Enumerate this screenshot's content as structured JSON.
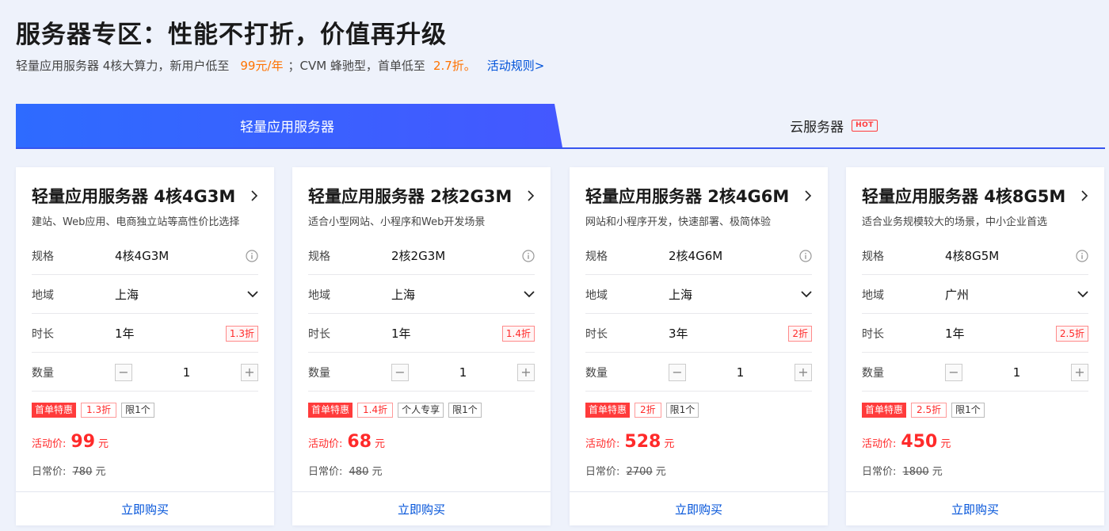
{
  "header": {
    "title": "服务器专区：性能不打折，价值再升级",
    "subtitle_part1": "轻量应用服务器 4核大算力，新用户低至",
    "subtitle_price": "99元/年",
    "subtitle_part2": "；CVM 蜂驰型，首单低至",
    "subtitle_discount": "2.7折。",
    "rules_link": "活动规则>"
  },
  "tabs": [
    {
      "label": "轻量应用服务器",
      "active": true
    },
    {
      "label": "云服务器",
      "badge": "HOT",
      "active": false
    }
  ],
  "labels": {
    "spec": "规格",
    "region": "地域",
    "duration": "时长",
    "quantity": "数量",
    "price_label": "活动价:",
    "orig_label": "日常价:",
    "unit": "元",
    "buy": "立即购买",
    "first_order": "首单特惠",
    "limit": "限1个",
    "personal": "个人专享"
  },
  "cards": [
    {
      "title": "轻量应用服务器 4核4G3M",
      "desc": "建站、Web应用、电商独立站等高性价比选择",
      "spec": "4核4G3M",
      "region": "上海",
      "duration": "1年",
      "discount": "1.3折",
      "quantity": "1",
      "price": "99",
      "orig_price": "780"
    },
    {
      "title": "轻量应用服务器 2核2G3M",
      "desc": "适合小型网站、小程序和Web开发场景",
      "spec": "2核2G3M",
      "region": "上海",
      "duration": "1年",
      "discount": "1.4折",
      "quantity": "1",
      "price": "68",
      "orig_price": "480"
    },
    {
      "title": "轻量应用服务器 2核4G6M",
      "desc": "网站和小程序开发，快速部署、极简体验",
      "spec": "2核4G6M",
      "region": "上海",
      "duration": "3年",
      "discount": "2折",
      "quantity": "1",
      "price": "528",
      "orig_price": "2700"
    },
    {
      "title": "轻量应用服务器 4核8G5M",
      "desc": "适合业务规模较大的场景，中小企业首选",
      "spec": "4核8G5M",
      "region": "广州",
      "duration": "1年",
      "discount": "2.5折",
      "quantity": "1",
      "price": "450",
      "orig_price": "1800"
    }
  ]
}
